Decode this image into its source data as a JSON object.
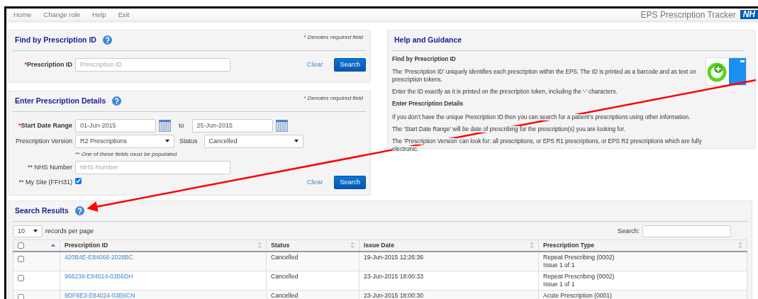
{
  "nav": {
    "items": [
      "Home",
      "Change role",
      "Help",
      "Exit"
    ],
    "app_title": "EPS Prescription Tracker",
    "logo_text": "NH"
  },
  "find_panel": {
    "title": "Find by Prescription ID",
    "required_note": {
      "marker": "*",
      "text": "Denotes required field"
    },
    "field": {
      "marker": "*",
      "label": "Prescription ID",
      "placeholder": "Prescription ID"
    },
    "clear": "Clear",
    "search": "Search"
  },
  "details_panel": {
    "title": "Enter Prescription Details",
    "required_note": {
      "marker": "*",
      "text": "Denotes required field"
    },
    "start_date": {
      "marker": "*",
      "label": "Start Date Range",
      "from": "01-Jun-2015",
      "to_label": "to",
      "to": "25-Jun-2015"
    },
    "version": {
      "label": "Prescription Version",
      "value": "R2 Prescriptions"
    },
    "status": {
      "label": "Status",
      "value": "Cancelled"
    },
    "hint": "** One of these fields must be populated",
    "nhs_number": {
      "label": "** NHS Number",
      "placeholder": "NHS Number"
    },
    "my_site": {
      "label": "** My Site (FFH31)",
      "checked": true
    },
    "clear": "Clear",
    "search": "Search"
  },
  "help": {
    "title": "Help and Guidance",
    "sections": [
      {
        "heading": "Find by Prescription ID",
        "paragraphs": [
          "The ‘Prescription ID’ uniquely identifies each prescription within the EPS. The ID is printed as a barcode and as text on prescription tokens.",
          "Enter the ID exactly as it is printed on the prescription token, including the '-' characters."
        ]
      },
      {
        "heading": "Enter Prescription Details",
        "paragraphs": [
          "If you don’t have the unique Prescription ID then you can search for a patient’s prescriptions using other information.",
          "The ‘Start Date Range’ will be date of prescribing for the prescription(s) you are looking for.",
          "The ‘Prescription Version’ can look for: all prescriptions, or EPS R1 prescriptions, or EPS R2 prescriptions which are fully electronic."
        ]
      }
    ]
  },
  "results": {
    "title": "Search Results",
    "page_size": "10",
    "per_page_label": "records per page",
    "search_label": "Search:",
    "select_column": {
      "checked": false,
      "sorted": true
    },
    "columns": [
      {
        "label": "Prescription ID",
        "sorted": false
      },
      {
        "label": "Status",
        "sorted": false
      },
      {
        "label": "Issue Date",
        "sorted": false
      },
      {
        "label": "Prescription Type",
        "sorted": false
      }
    ],
    "rows": [
      {
        "checked": false,
        "id": "420B4E-E84068-2028BC",
        "status": "Cancelled",
        "issue_date": "19-Jun-2015 12:26:36",
        "type_lines": [
          "Repeat Prescribing (0002)",
          "Issue 1 of 1"
        ]
      },
      {
        "checked": false,
        "id": "966238-E84024-03B6DH",
        "status": "Cancelled",
        "issue_date": "23-Jun-2015 18:00:33",
        "type_lines": [
          "Repeat Prescribing (0002)",
          "Issue 1 of 1"
        ]
      },
      {
        "checked": false,
        "id": "9DF6E3-E84024-03B6CN",
        "status": "Cancelled",
        "issue_date": "23-Jun-2015 18:00:30",
        "type_lines": [
          "Acute Prescription (0001)"
        ]
      }
    ]
  }
}
